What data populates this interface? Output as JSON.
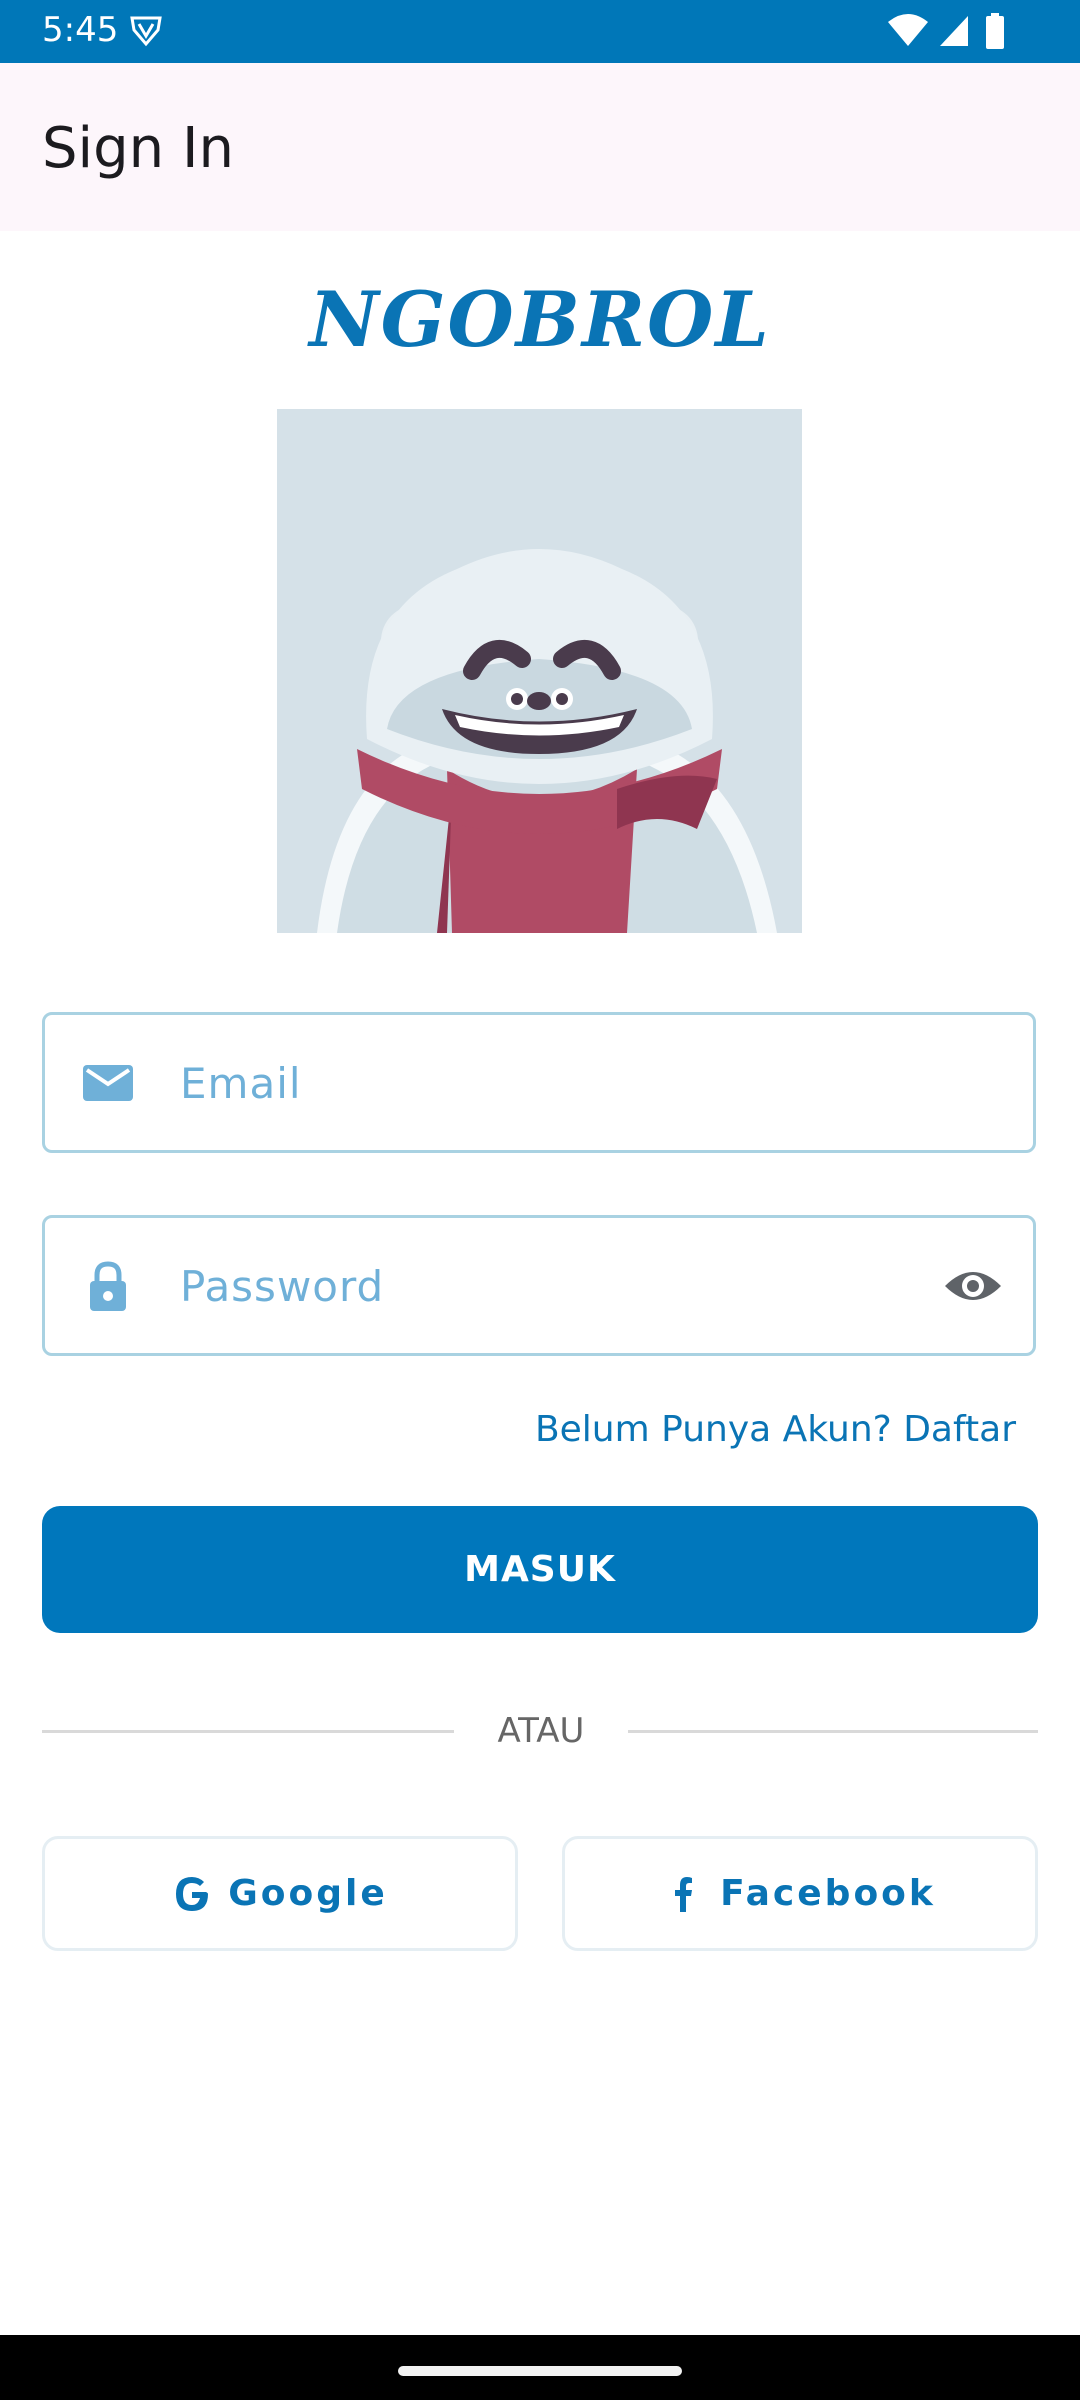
{
  "status_bar": {
    "time": "5:45",
    "bg_color": "#0077b8",
    "icons": [
      "vpn-shield-icon",
      "wifi-icon",
      "signal-icon",
      "battery-icon"
    ]
  },
  "app_bar": {
    "title": "Sign In"
  },
  "logo": {
    "text": "NGOBROL",
    "color": "#0a74b5"
  },
  "mascot": {
    "description_icon": "polar-bear-mascot"
  },
  "form": {
    "email": {
      "placeholder": "Email",
      "value": "",
      "icon": "mail-icon"
    },
    "password": {
      "placeholder": "Password",
      "value": "",
      "icon": "lock-icon",
      "toggle_icon": "eye-icon"
    },
    "register_link": "Belum Punya Akun? Daftar",
    "login_button": "MASUK",
    "divider_text": "ATAU"
  },
  "social": {
    "google_label": "Google",
    "facebook_label": "Facebook",
    "google_icon": "google-g-icon",
    "facebook_icon": "facebook-f-icon"
  },
  "colors": {
    "primary": "#0077bc",
    "field_border": "#a9d2e2",
    "app_bar_bg": "#fdf6fb"
  }
}
